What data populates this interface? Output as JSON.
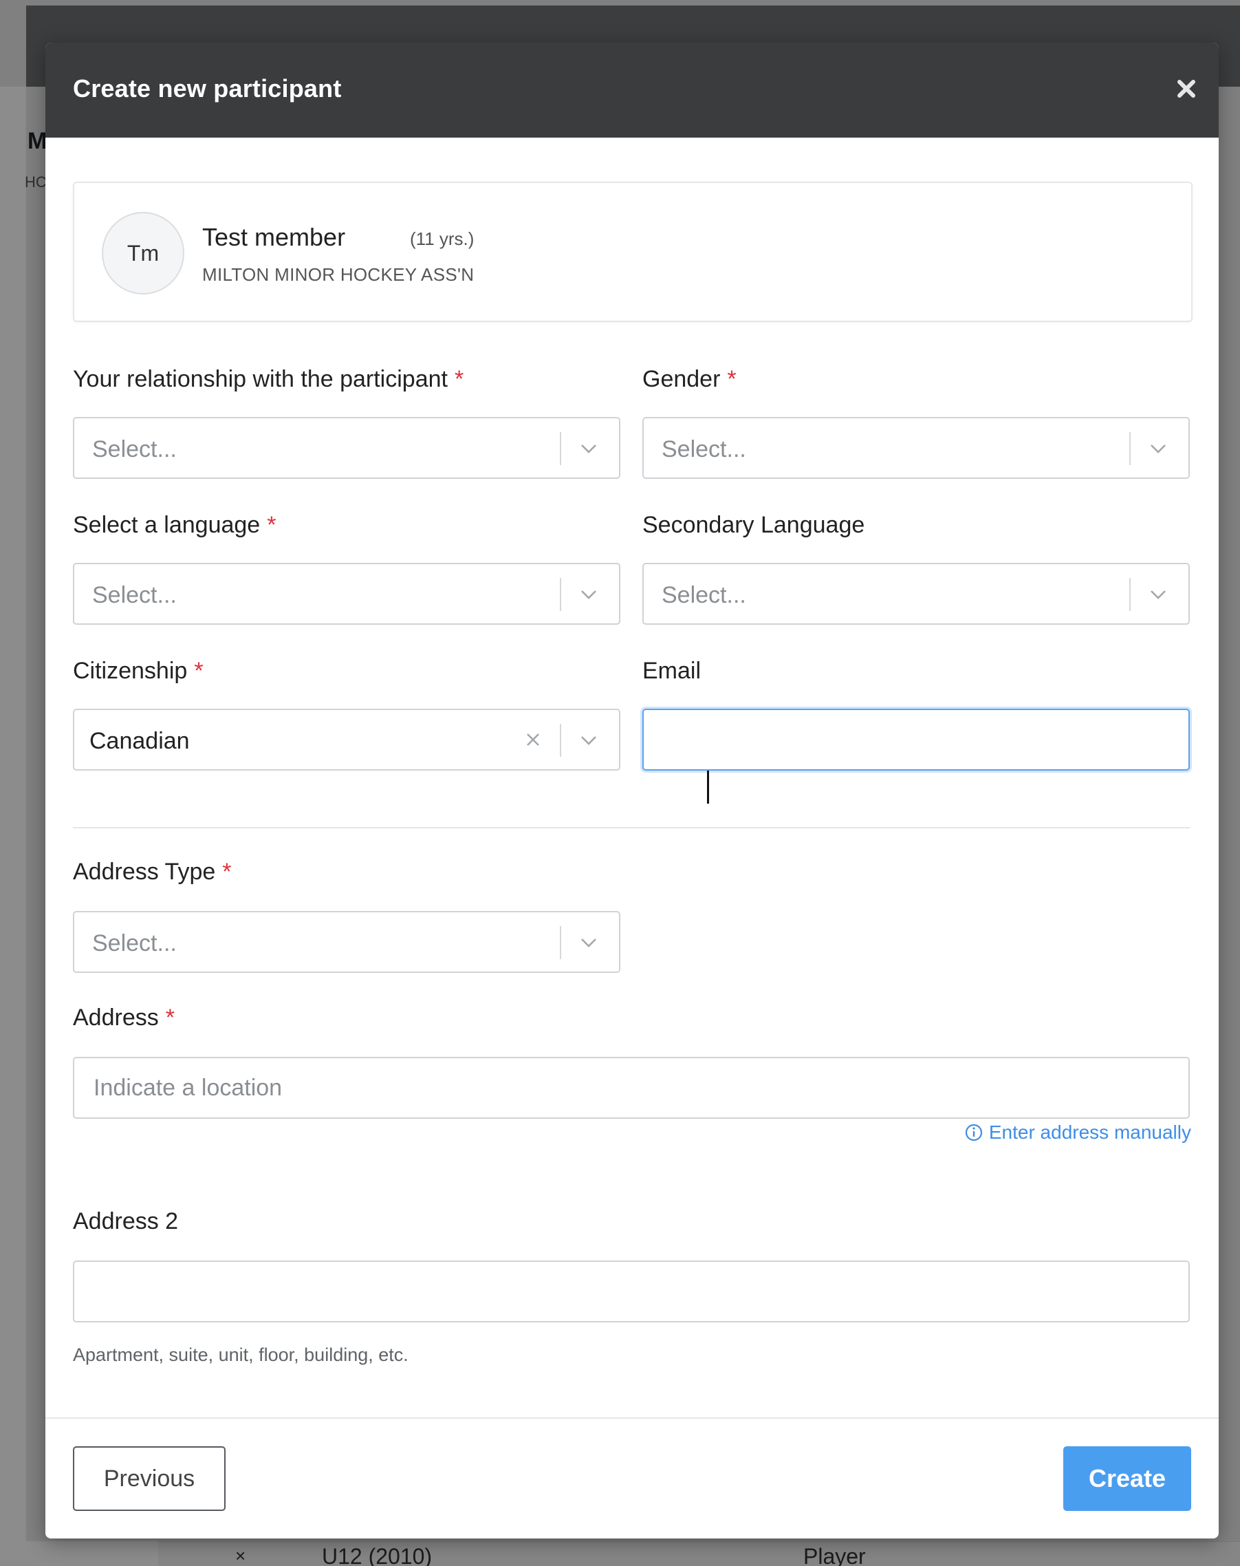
{
  "background": {
    "heading_initial": "M",
    "subheading_initial": "HC",
    "row_marker": "×",
    "row_team": "U12 (2010)",
    "row_role": "Player"
  },
  "modal": {
    "title": "Create new participant",
    "close_icon": "close-icon"
  },
  "member": {
    "initials": "Tm",
    "name": "Test member",
    "age": "(11 yrs.)",
    "organization": "MILTON MINOR HOCKEY ASS'N"
  },
  "required_marker": "*",
  "fields": {
    "relationship": {
      "label": "Your relationship with the participant",
      "placeholder": "Select..."
    },
    "gender": {
      "label": "Gender",
      "placeholder": "Select..."
    },
    "language": {
      "label": "Select a language",
      "placeholder": "Select..."
    },
    "secondary_language": {
      "label": "Secondary Language",
      "placeholder": "Select..."
    },
    "citizenship": {
      "label": "Citizenship",
      "value": "Canadian"
    },
    "email": {
      "label": "Email",
      "value": ""
    },
    "address_type": {
      "label": "Address Type",
      "placeholder": "Select..."
    },
    "address": {
      "label": "Address",
      "placeholder": "Indicate a location"
    },
    "address_manual_link": "Enter address manually",
    "address2": {
      "label": "Address 2",
      "value": "",
      "help": "Apartment, suite, unit, floor, building, etc."
    }
  },
  "footer": {
    "previous_label": "Previous",
    "create_label": "Create"
  },
  "colors": {
    "header_bg": "#3b3c3e",
    "required": "#e0303a",
    "primary": "#4a9ef0",
    "link": "#3d8ee6"
  }
}
